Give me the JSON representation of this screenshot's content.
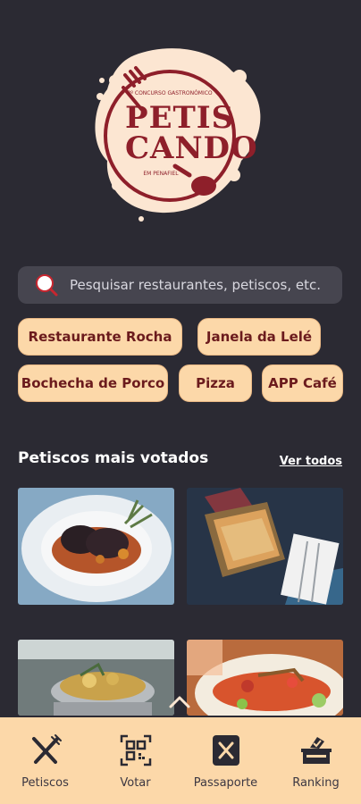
{
  "logo": {
    "edition_text": "3º CONCURSO GASTRONÓMICO",
    "title_line1": "PETIS",
    "title_line2": "CANDO",
    "location_text": "EM PENAFIEL"
  },
  "search": {
    "placeholder": "Pesquisar restaurantes, petiscos, etc."
  },
  "chips": [
    {
      "label": "Restaurante Rocha"
    },
    {
      "label": "Janela da Lelé"
    },
    {
      "label": "Bochecha de Porco"
    },
    {
      "label": "Pizza"
    },
    {
      "label": "APP Café"
    }
  ],
  "section": {
    "title": "Petiscos mais votados",
    "see_all": "Ver todos"
  },
  "nav": {
    "items": [
      {
        "label": "Petiscos",
        "icon": "cutlery-icon"
      },
      {
        "label": "Votar",
        "icon": "qr-code-icon"
      },
      {
        "label": "Passaporte",
        "icon": "passport-icon"
      },
      {
        "label": "Ranking",
        "icon": "ballot-box-icon"
      }
    ]
  },
  "colors": {
    "background": "#2b2a33",
    "chip": "#fcd8a9",
    "chip_text": "#6b1b1d",
    "brand_red": "#8e1f2a",
    "nav_bg": "#fcd8a9"
  }
}
